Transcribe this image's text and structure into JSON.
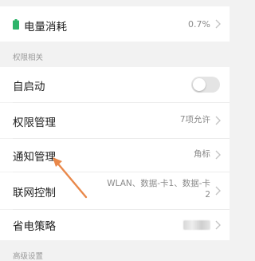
{
  "battery": {
    "label": "电量消耗",
    "value": "0.7%",
    "icon": "battery-icon",
    "icon_color": "#2db46a"
  },
  "permissions": {
    "header": "权限相关",
    "auto_start": {
      "label": "自启动",
      "enabled": false
    },
    "permission_management": {
      "label": "权限管理",
      "value": "7项允许"
    },
    "notification_management": {
      "label": "通知管理",
      "value": "角标"
    },
    "network_control": {
      "label": "联网控制",
      "value_line1": "WLAN、数据-卡1、数据-卡",
      "value_line2": "2"
    },
    "power_strategy": {
      "label": "省电策略"
    }
  },
  "next_section_header": "高级设置",
  "annotation": {
    "type": "arrow",
    "color": "#e9884a"
  },
  "colors": {
    "background": "#f2f2f2",
    "card": "#ffffff",
    "chevron": "#c4c4c4"
  }
}
